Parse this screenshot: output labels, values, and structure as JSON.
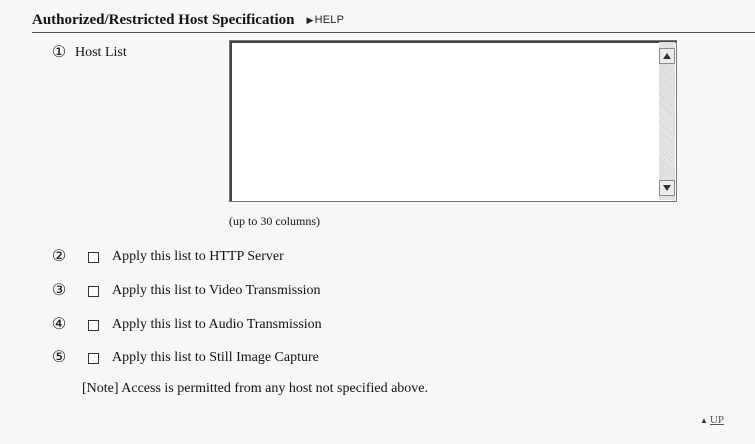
{
  "header": {
    "title": "Authorized/Restricted Host Specification",
    "help_arrow": "▶",
    "help_label": "HELP"
  },
  "host_list": {
    "number": "①",
    "label": "Host List",
    "value": "",
    "hint": "(up to 30 columns)"
  },
  "options": [
    {
      "number": "②",
      "label": "Apply this list to HTTP Server",
      "checked": false
    },
    {
      "number": "③",
      "label": "Apply this list to Video Transmission",
      "checked": false
    },
    {
      "number": "④",
      "label": "Apply this list to Audio Transmission",
      "checked": false
    },
    {
      "number": "⑤",
      "label": "Apply this list to Still Image Capture",
      "checked": false
    }
  ],
  "note": "[Note] Access is permitted from any host not specified above.",
  "footer": {
    "up_arrow": "▲",
    "up_label": "UP"
  }
}
